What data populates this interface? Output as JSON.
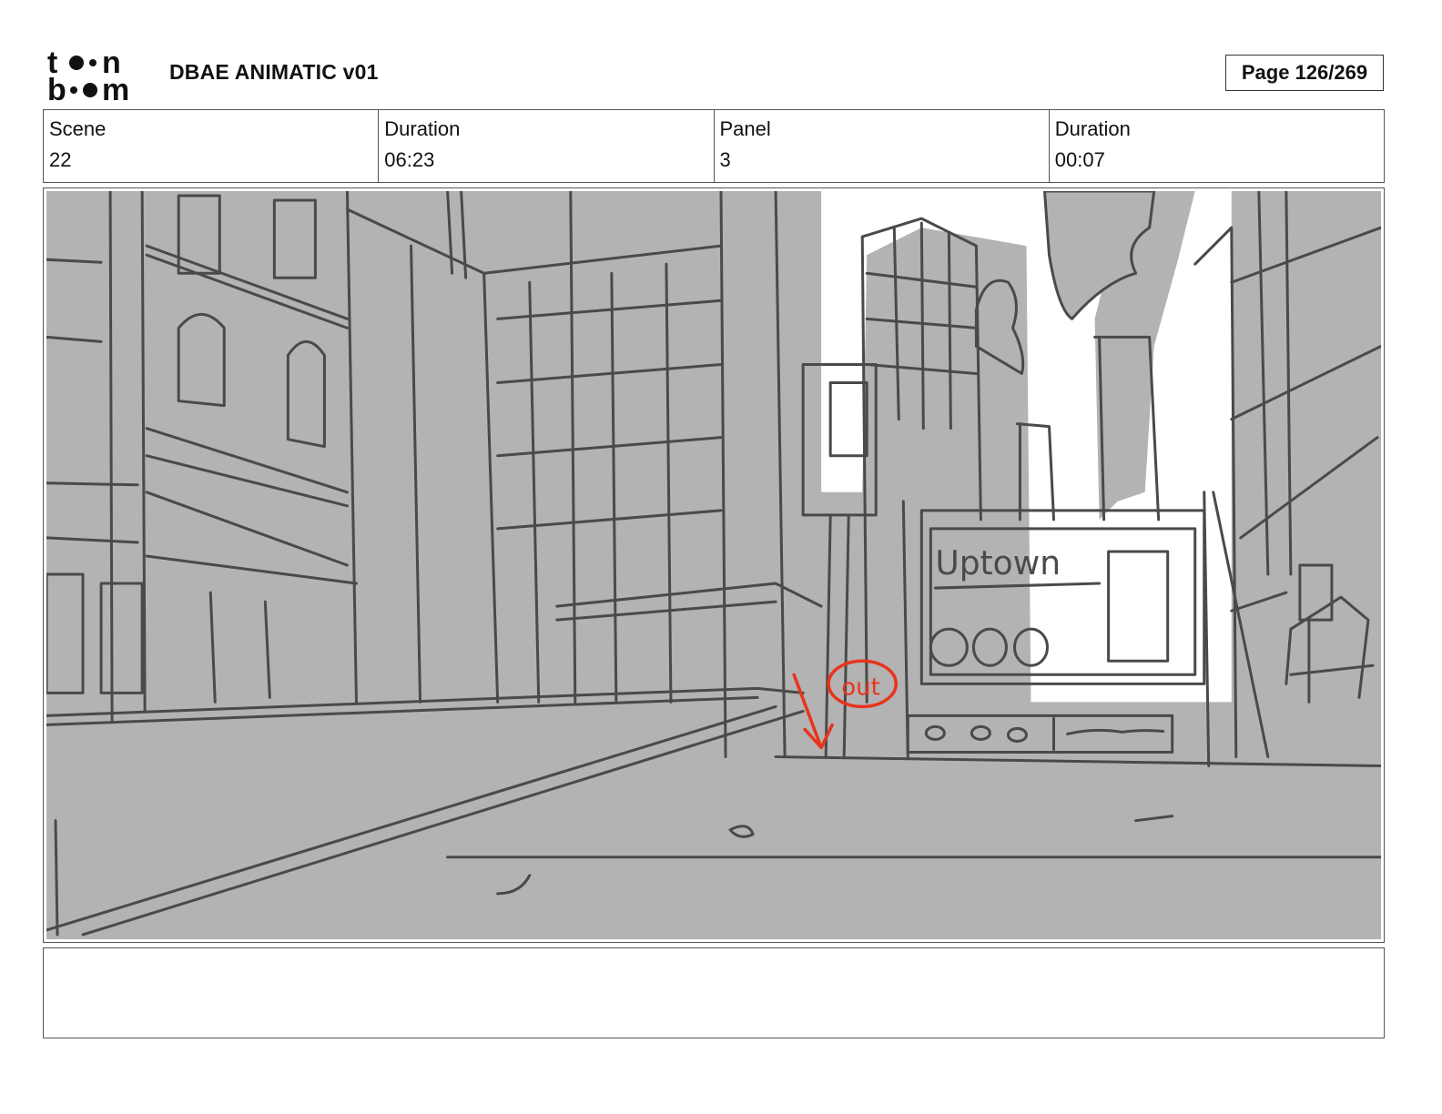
{
  "header": {
    "title": "DBAE ANIMATIC v01",
    "page_label": "Page 126/269",
    "logo": {
      "icon": "toonboom-logo-icon",
      "line1": "toon",
      "line2": "boom"
    }
  },
  "info": [
    {
      "label": "Scene",
      "value": "22"
    },
    {
      "label": "Duration",
      "value": "06:23"
    },
    {
      "label": "Panel",
      "value": "3"
    },
    {
      "label": "Duration",
      "value": "00:07"
    }
  ],
  "panel": {
    "sign_text": "Uptown",
    "annotation_text": "out",
    "colors": {
      "background": "#b3b3b3",
      "sketch": "#4a4a4a",
      "annotation": "#e8341c",
      "sky": "#ffffff"
    }
  },
  "notes": {
    "text": ""
  }
}
